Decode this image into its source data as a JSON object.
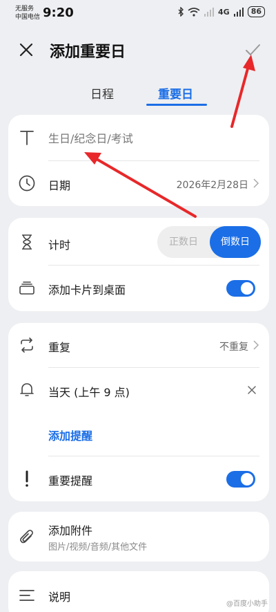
{
  "status_bar": {
    "carrier_line1": "无服务",
    "carrier_line2": "中国电信",
    "time": "9:20",
    "network": "4G",
    "battery": "86"
  },
  "header": {
    "title": "添加重要日",
    "close_icon": "close-icon",
    "confirm_icon": "check-icon"
  },
  "tabs": [
    {
      "label": "日程",
      "active": false
    },
    {
      "label": "重要日",
      "active": true
    }
  ],
  "title_field": {
    "placeholder": "生日/纪念日/考试",
    "icon": "text-T-icon"
  },
  "date_row": {
    "label": "日期",
    "value": "2026年2月28日",
    "icon": "clock-icon"
  },
  "timing_row": {
    "label": "计时",
    "icon": "hourglass-icon",
    "options": [
      "正数日",
      "倒数日"
    ],
    "selected": "倒数日"
  },
  "card_to_desktop": {
    "label": "添加卡片到桌面",
    "toggle_on": true,
    "icon": "card-stack-icon"
  },
  "repeat_row": {
    "label": "重复",
    "value": "不重复",
    "icon": "repeat-icon"
  },
  "reminder_row": {
    "label": "当天 (上午 9 点)",
    "icon": "bell-icon"
  },
  "add_reminder": {
    "label": "添加提醒"
  },
  "important_reminder": {
    "label": "重要提醒",
    "toggle_on": true,
    "icon": "exclamation-icon"
  },
  "attachment": {
    "label": "添加附件",
    "sub": "图片/视频/音频/其他文件",
    "icon": "paperclip-icon"
  },
  "description": {
    "label": "说明",
    "icon": "lines-icon"
  },
  "watermark": "@百度小助手",
  "colors": {
    "accent": "#1b6ee6",
    "background": "#eeeff2",
    "annotation_arrow": "#e8282a"
  }
}
